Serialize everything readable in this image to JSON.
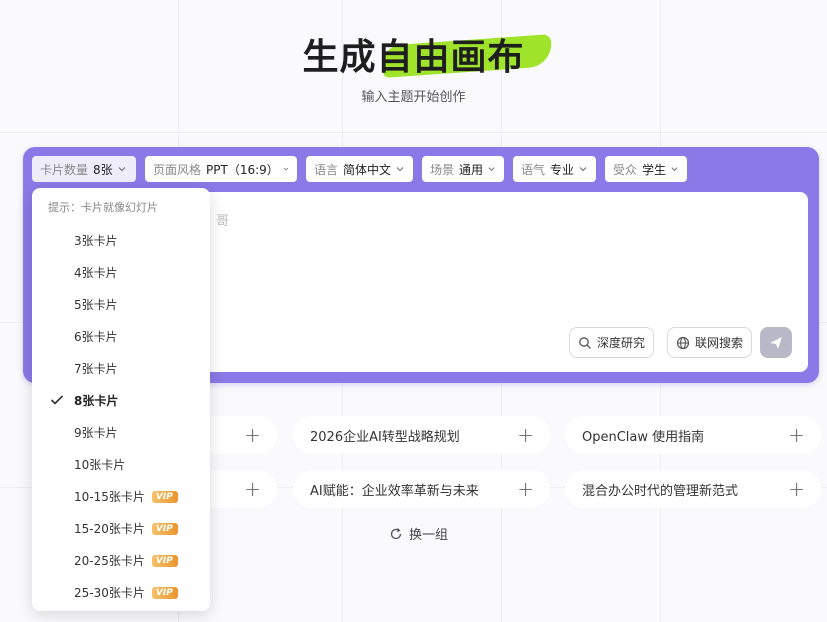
{
  "header": {
    "title_part1": "生成",
    "title_part2": "自由画布",
    "subtitle": "输入主题开始创作"
  },
  "options": [
    {
      "label": "卡片数量",
      "value": "8张"
    },
    {
      "label": "页面风格",
      "value": "PPT（16:9）"
    },
    {
      "label": "语言",
      "value": "简体中文"
    },
    {
      "label": "场景",
      "value": "通用"
    },
    {
      "label": "语气",
      "value": "专业"
    },
    {
      "label": "受众",
      "value": "学生"
    }
  ],
  "input": {
    "partial_placeholder": "哥",
    "deep_research_label": "深度研究",
    "web_search_label": "联网搜索"
  },
  "suggestions": [
    {
      "text": ""
    },
    {
      "text": "2026企业AI转型战略规划"
    },
    {
      "text": "OpenClaw 使用指南"
    },
    {
      "text": ""
    },
    {
      "text": "AI赋能：企业效率革新与未来"
    },
    {
      "text": "混合办公时代的管理新范式"
    }
  ],
  "refresh_label": "换一组",
  "card_count_dropdown": {
    "hint": "提示：卡片就像幻灯片",
    "vip_badge": "VIP",
    "items": [
      {
        "label": "3张卡片",
        "selected": false,
        "vip": false
      },
      {
        "label": "4张卡片",
        "selected": false,
        "vip": false
      },
      {
        "label": "5张卡片",
        "selected": false,
        "vip": false
      },
      {
        "label": "6张卡片",
        "selected": false,
        "vip": false
      },
      {
        "label": "7张卡片",
        "selected": false,
        "vip": false
      },
      {
        "label": "8张卡片",
        "selected": true,
        "vip": false
      },
      {
        "label": "9张卡片",
        "selected": false,
        "vip": false
      },
      {
        "label": "10张卡片",
        "selected": false,
        "vip": false
      },
      {
        "label": "10-15张卡片",
        "selected": false,
        "vip": true
      },
      {
        "label": "15-20张卡片",
        "selected": false,
        "vip": true
      },
      {
        "label": "20-25张卡片",
        "selected": false,
        "vip": true
      },
      {
        "label": "25-30张卡片",
        "selected": false,
        "vip": true
      }
    ]
  },
  "colors": {
    "accent_purple": "#8b79e8",
    "highlight_green": "#9fe32a",
    "vip_orange": "#e9962f"
  }
}
